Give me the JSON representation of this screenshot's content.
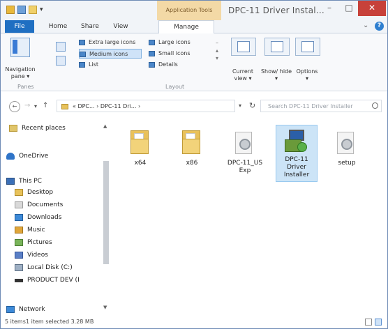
{
  "title_bar": {
    "context_tab": "Application Tools",
    "window_title": "DPC-11 Driver Instal...",
    "controls": {
      "minimize": "–",
      "maximize": "□",
      "close": "✕"
    }
  },
  "ribbon_tabs": {
    "file": "File",
    "home": "Home",
    "share": "Share",
    "view": "View",
    "manage": "Manage"
  },
  "ribbon": {
    "navigation_pane": "Navigation pane ▾",
    "layout": {
      "extra_large": "Extra large icons",
      "large": "Large icons",
      "medium": "Medium icons",
      "small": "Small icons",
      "list": "List",
      "details": "Details"
    },
    "current_view": "Current view ▾",
    "show_hide": "Show/ hide ▾",
    "options": "Options",
    "options_drop": "▾",
    "group_panes": "Panes",
    "group_layout": "Layout"
  },
  "address": {
    "back": "←",
    "forward": "→",
    "dropdown": "▾",
    "up": "↑",
    "path": "« DPC... › DPC-11 Dri... ›",
    "refresh": "↻",
    "search_placeholder": "Search DPC-11 Driver Installer"
  },
  "nav_pane": {
    "items": [
      {
        "label": "Recent places",
        "icon": "recent-places-icon"
      },
      {
        "label": "OneDrive",
        "icon": "onedrive-icon"
      },
      {
        "label": "This PC",
        "icon": "this-pc-icon"
      },
      {
        "label": "Desktop",
        "icon": "desktop-folder-icon"
      },
      {
        "label": "Documents",
        "icon": "documents-folder-icon"
      },
      {
        "label": "Downloads",
        "icon": "downloads-folder-icon"
      },
      {
        "label": "Music",
        "icon": "music-folder-icon"
      },
      {
        "label": "Pictures",
        "icon": "pictures-folder-icon"
      },
      {
        "label": "Videos",
        "icon": "videos-folder-icon"
      },
      {
        "label": "Local Disk (C:)",
        "icon": "local-disk-icon"
      },
      {
        "label": "PRODUCT DEV (I",
        "icon": "usb-drive-icon"
      },
      {
        "label": "Network",
        "icon": "network-icon"
      }
    ]
  },
  "files": [
    {
      "name": "x64",
      "type": "folder"
    },
    {
      "name": "x86",
      "type": "folder"
    },
    {
      "name": "DPC-11_US Exp",
      "type": "settings"
    },
    {
      "name": "DPC-11 Driver Installer",
      "type": "application",
      "selected": true
    },
    {
      "name": "setup",
      "type": "settings"
    }
  ],
  "status_bar": {
    "items": "5 items",
    "selected": "1 item selected  3.28 MB"
  }
}
